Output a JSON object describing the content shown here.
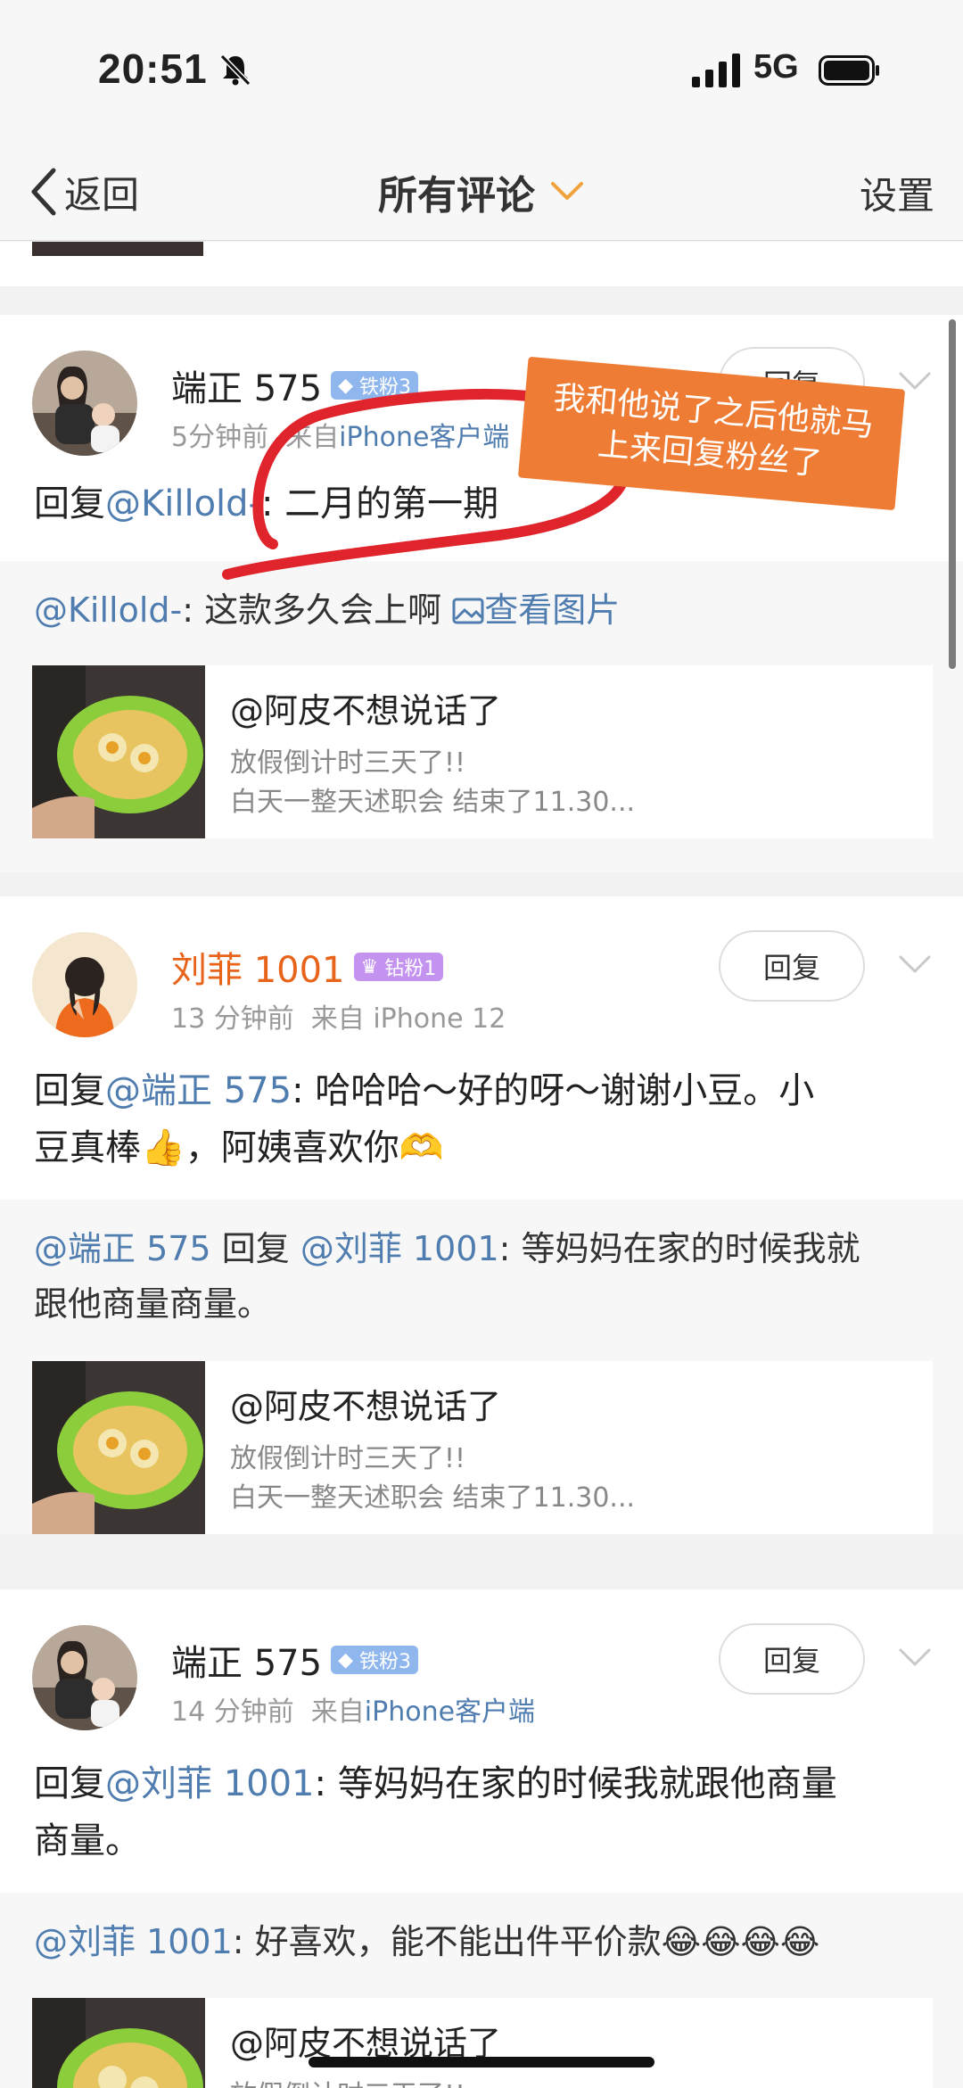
{
  "status": {
    "time": "20:51",
    "network": "5G"
  },
  "nav": {
    "back_label": "返回",
    "title": "所有评论",
    "settings_label": "设置"
  },
  "colors": {
    "link": "#507daf",
    "orange_user": "#e8641b",
    "sticker": "#ee7c34",
    "annotation_red": "#e0242b"
  },
  "annotation": {
    "line1": "我和他说了之后他就马",
    "line2": "上来回复粉丝了"
  },
  "comments": [
    {
      "username": "端正 575",
      "badge": "铁粉3",
      "time": "5分钟前",
      "source_prefix": "来自",
      "source": "iPhone客户端",
      "reply_label": "回复",
      "reply_prefix": "回复",
      "reply_mention": "@Killold-",
      "reply_text": ": 二月的第一期",
      "quote": {
        "mention": "@Killold-",
        "text": ": 这款多久会上啊",
        "view_image": "查看图片"
      },
      "repost": {
        "author": "@阿皮不想说话了",
        "line1": "放假倒计时三天了!!",
        "line2": "白天一整天述职会 结束了11.30..."
      }
    },
    {
      "username": "刘菲 1001",
      "badge": "钻粉1",
      "time": "13 分钟前",
      "source_prefix": "来自",
      "source": "iPhone 12",
      "reply_label": "回复",
      "reply_prefix": "回复",
      "reply_mention": "@端正 575",
      "reply_text_line1": ": 哈哈哈～好的呀～谢谢小豆。小",
      "reply_text_line2": "豆真棒👍，阿姨喜欢你🫶",
      "quote": {
        "mention1": "@端正 575",
        "middle": "回复",
        "mention2": "@刘菲 1001",
        "text_line1": ": 等妈妈在家的时候我就",
        "text_line2": "跟他商量商量。"
      },
      "repost": {
        "author": "@阿皮不想说话了",
        "line1": "放假倒计时三天了!!",
        "line2": "白天一整天述职会 结束了11.30..."
      }
    },
    {
      "username": "端正 575",
      "badge": "铁粉3",
      "time": "14 分钟前",
      "source_prefix": "来自",
      "source": "iPhone客户端",
      "reply_label": "回复",
      "reply_prefix": "回复",
      "reply_mention": "@刘菲 1001",
      "reply_text_line1": ": 等妈妈在家的时候我就跟他商量",
      "reply_text_line2": "商量。",
      "quote": {
        "mention": "@刘菲 1001",
        "text": ": 好喜欢，能不能出件平价款😂😂😂😂"
      },
      "repost": {
        "author": "@阿皮不想说话了",
        "line1": "放假倒计时三天了!!"
      }
    }
  ]
}
